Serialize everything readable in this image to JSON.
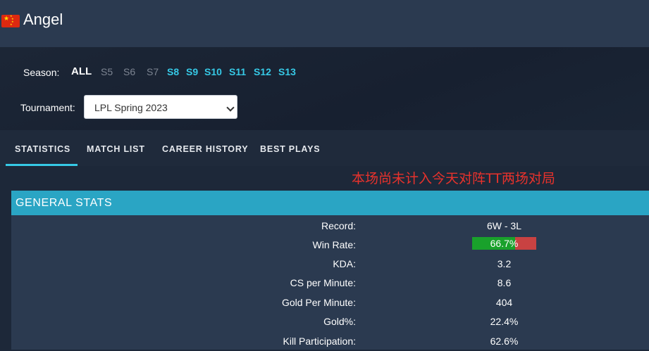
{
  "player": {
    "name": "Angel",
    "flag_icon": "china-flag-icon"
  },
  "filters": {
    "season_label": "Season:",
    "seasons": [
      {
        "label": "ALL",
        "state": "selected"
      },
      {
        "label": "S5",
        "state": "disabled"
      },
      {
        "label": "S6",
        "state": "disabled"
      },
      {
        "label": "S7",
        "state": "disabled"
      },
      {
        "label": "S8",
        "state": "enabled"
      },
      {
        "label": "S9",
        "state": "enabled"
      },
      {
        "label": "S10",
        "state": "enabled"
      },
      {
        "label": "S11",
        "state": "enabled"
      },
      {
        "label": "S12",
        "state": "enabled"
      },
      {
        "label": "S13",
        "state": "enabled"
      }
    ],
    "tournament_label": "Tournament:",
    "tournament_value": "LPL Spring 2023"
  },
  "tabs": [
    {
      "label": "STATISTICS",
      "active": true
    },
    {
      "label": "MATCH LIST",
      "active": false
    },
    {
      "label": "CAREER HISTORY",
      "active": false
    },
    {
      "label": "BEST PLAYS",
      "active": false
    }
  ],
  "annotation": "本场尚未计入今天对阵TT两场对局",
  "general_stats": {
    "title": "GENERAL STATS",
    "rows": [
      {
        "label": "Record:",
        "value": "6W - 3L"
      },
      {
        "label": "Win Rate:",
        "value": "66.7%",
        "fraction": 0.667
      },
      {
        "label": "KDA:",
        "value": "3.2"
      },
      {
        "label": "CS per Minute:",
        "value": "8.6"
      },
      {
        "label": "Gold Per Minute:",
        "value": "404"
      },
      {
        "label": "Gold%:",
        "value": "22.4%"
      },
      {
        "label": "Kill Participation:",
        "value": "62.6%"
      }
    ]
  },
  "colors": {
    "accent": "#36c9e6",
    "panel_header": "#2aa5c4",
    "win": "#19a12b",
    "loss": "#c94242",
    "annotation": "#e8322c"
  }
}
